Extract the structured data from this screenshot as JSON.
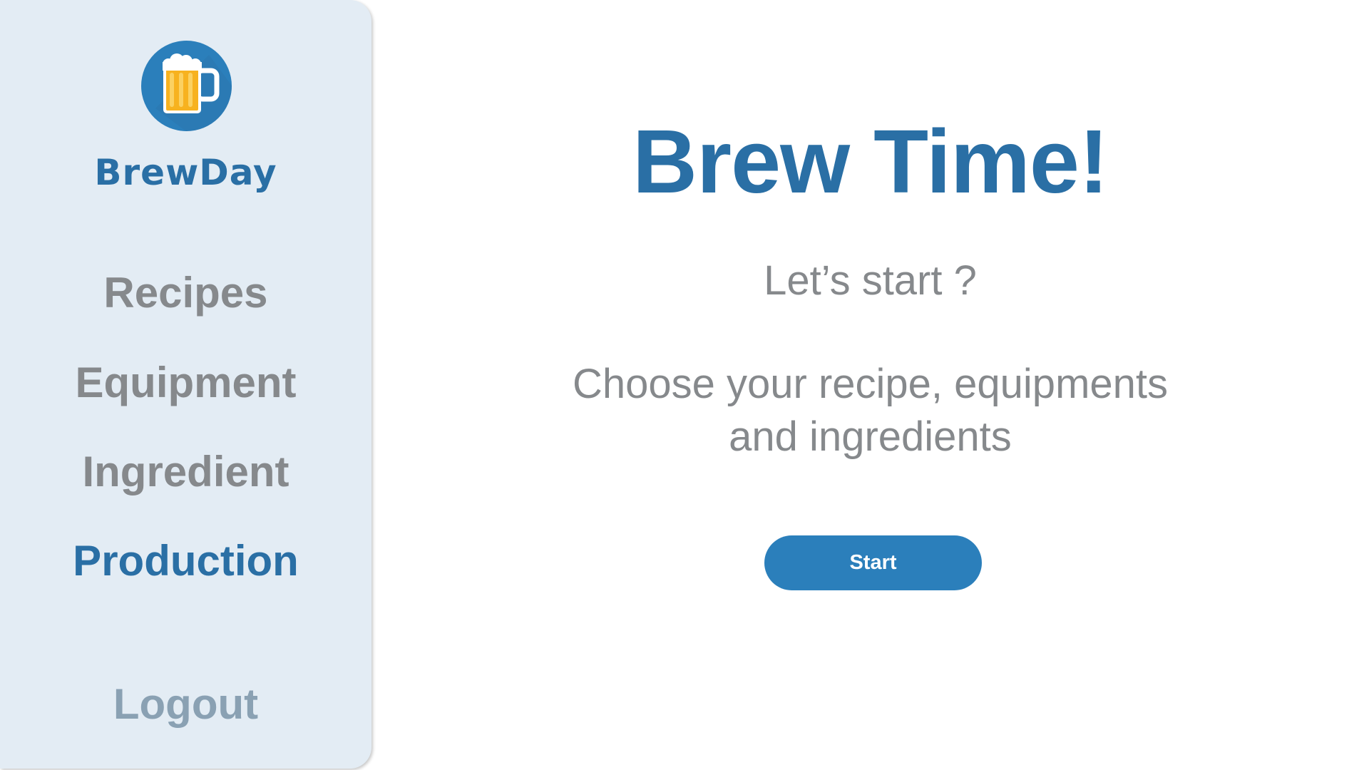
{
  "sidebar": {
    "brand": {
      "name": "BrewDay",
      "logo_icon": "beer-mug-icon"
    },
    "nav": {
      "recipes": "Recipes",
      "equipment": "Equipment",
      "ingredient": "Ingredient",
      "production": "Production",
      "active": "production"
    },
    "logout": "Logout"
  },
  "main": {
    "title": "Brew Time!",
    "subtitle": "Let’s start ?",
    "description_line1": "Choose your recipe, equipments",
    "description_line2": "and ingredients",
    "start_button": "Start"
  },
  "colors": {
    "accent": "#2a6fa5",
    "button": "#2b7fbb",
    "sidebar_bg": "#e3ecf4",
    "muted_text": "#86898c",
    "logout_text": "#8aa1b3",
    "beer": "#f7b21f"
  }
}
